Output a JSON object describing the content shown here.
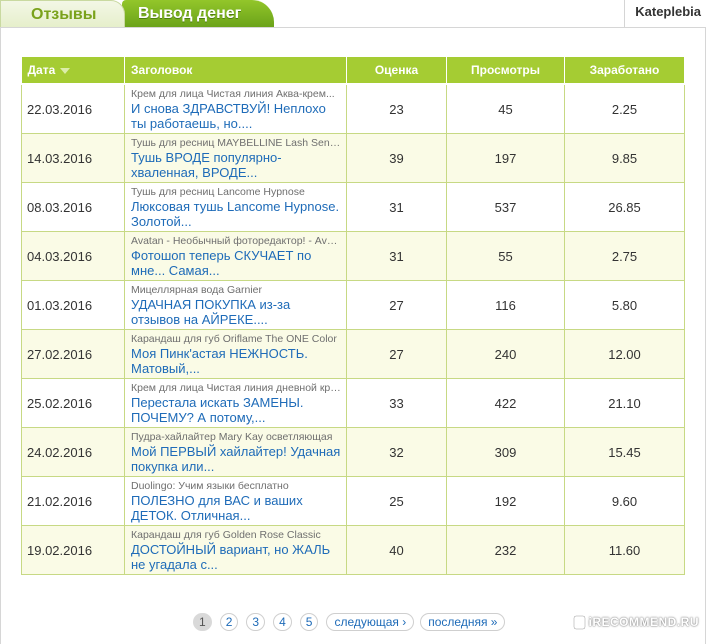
{
  "tabs": {
    "reviews": "Отзывы",
    "withdraw": "Вывод денег"
  },
  "user": {
    "name": "Kateplebia"
  },
  "table": {
    "headers": {
      "date": "Дата",
      "title": "Заголовок",
      "rating": "Оценка",
      "views": "Просмотры",
      "earned": "Заработано"
    },
    "rows": [
      {
        "date": "22.03.2016",
        "subject": "Крем для лица Чистая линия Аква-крем...",
        "headline": "И снова ЗДРАВСТВУЙ! Неплохо ты работаешь, но....",
        "rating": "23",
        "views": "45",
        "earned": "2.25"
      },
      {
        "date": "14.03.2016",
        "subject": "Тушь для ресниц MAYBELLINE Lash Sensational",
        "headline": "Тушь ВРОДЕ популярно-хваленная, ВРОДЕ...",
        "rating": "39",
        "views": "197",
        "earned": "9.85"
      },
      {
        "date": "08.03.2016",
        "subject": "Тушь для ресниц Lancome Hypnose",
        "headline": "Люксовая тушь Lancome Hypnose. Золотой...",
        "rating": "31",
        "views": "537",
        "earned": "26.85"
      },
      {
        "date": "04.03.2016",
        "subject": "Avatan - Необычный фоторедактор! - Avatan.ru",
        "headline": "Фотошоп теперь СКУЧАЕТ по мне... Самая...",
        "rating": "31",
        "views": "55",
        "earned": "2.75"
      },
      {
        "date": "01.03.2016",
        "subject": "Мицеллярная вода Garnier",
        "headline": "УДАЧНАЯ ПОКУПКА из-за отзывов на АЙРЕКЕ....",
        "rating": "27",
        "views": "116",
        "earned": "5.80"
      },
      {
        "date": "27.02.2016",
        "subject": "Карандаш для губ Oriflame The ONE Color",
        "headline": "Моя Пинк'астая НЕЖНОСТЬ. Матовый,...",
        "rating": "27",
        "views": "240",
        "earned": "12.00"
      },
      {
        "date": "25.02.2016",
        "subject": "Крем для лица Чистая линия дневной крем",
        "headline": "Перестала искать ЗАМЕНЫ. ПОЧЕМУ? А потому,...",
        "rating": "33",
        "views": "422",
        "earned": "21.10"
      },
      {
        "date": "24.02.2016",
        "subject": "Пудра-хайлайтер Mary Kay осветляющая",
        "headline": "Мой ПЕРВЫЙ хайлайтер! Удачная покупка или...",
        "rating": "32",
        "views": "309",
        "earned": "15.45"
      },
      {
        "date": "21.02.2016",
        "subject": "Duolingo: Учим языки бесплатно",
        "headline": "ПОЛЕЗНО для ВАС и ваших ДЕТОК. Отличная...",
        "rating": "25",
        "views": "192",
        "earned": "9.60"
      },
      {
        "date": "19.02.2016",
        "subject": "Карандаш для губ Golden Rose Classic",
        "headline": "ДОСТОЙНЫЙ вариант, но ЖАЛЬ не угадала с...",
        "rating": "40",
        "views": "232",
        "earned": "11.60"
      }
    ]
  },
  "pagination": {
    "pages": [
      "1",
      "2",
      "3",
      "4",
      "5"
    ],
    "current": "1",
    "next": "следующая ›",
    "last": "последняя »"
  },
  "watermark": "iRECOMMEND.RU",
  "colors": {
    "accent_green": "#a5cc33",
    "tab_green": "#7aa21c",
    "link_blue": "#1e6bb8",
    "row_alt": "#fafbe6"
  }
}
